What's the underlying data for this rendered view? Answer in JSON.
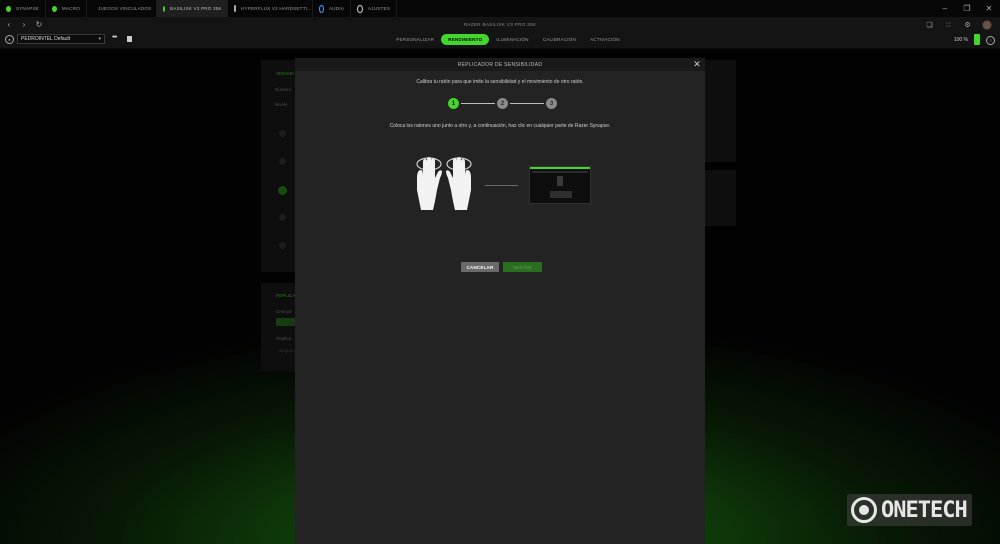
{
  "tabs": [
    {
      "label": "SYNAPSE",
      "color": "#44d62c",
      "active": false
    },
    {
      "label": "MACRO",
      "color": "#44d62c",
      "active": false
    },
    {
      "label": "JUEGOS VINCULADOS",
      "color": "#44d62c",
      "active": false
    },
    {
      "label": "BASILISK V3 PRO 35K",
      "color": "#555555",
      "active": true
    },
    {
      "label": "HYPERFLUX V2 HARDSETTI...",
      "color": "#aaaaaa",
      "active": false
    },
    {
      "label": "AUDIA",
      "color": "#3aa0ff",
      "active": false
    },
    {
      "label": "AJUSTES",
      "color": "#cccccc",
      "active": false
    }
  ],
  "device_title": "RAZER BASILISK V3 PRO 35K",
  "profile": {
    "selected": "PEDROINTEL Default"
  },
  "menu": [
    {
      "label": "PERSONALIZAR",
      "active": false
    },
    {
      "label": "RENDIMIENTO",
      "active": true
    },
    {
      "label": "ILUMINACIÓN",
      "active": false
    },
    {
      "label": "CALIBRACIÓN",
      "active": false
    },
    {
      "label": "ACTIVACIÓN",
      "active": false
    }
  ],
  "battery": {
    "percent_label": "100 %",
    "level": 1.0
  },
  "background_panel": {
    "title": "SENSIBI",
    "line1": "Número",
    "line2": "Nivele",
    "rep_title": "REPLICAD",
    "rep_line1": "Crea pe",
    "rep_line2": "Replica",
    "rep_line3": "Ninguno"
  },
  "modal": {
    "title": "REPLICADOR DE SENSIBILIDAD",
    "instruction1": "Calibra tu ratón para que imite la sensibilidad y el movimiento de otro ratón.",
    "steps": [
      "1",
      "2",
      "3"
    ],
    "active_step": 1,
    "instruction2": "Coloca los ratones uno junto a otro y, a continuación, haz clic en cualquier parte de Razer Synapse.",
    "cancel_label": "CANCELAR",
    "start_label": "INICIAR"
  },
  "watermark": {
    "text": "ONETECH"
  }
}
